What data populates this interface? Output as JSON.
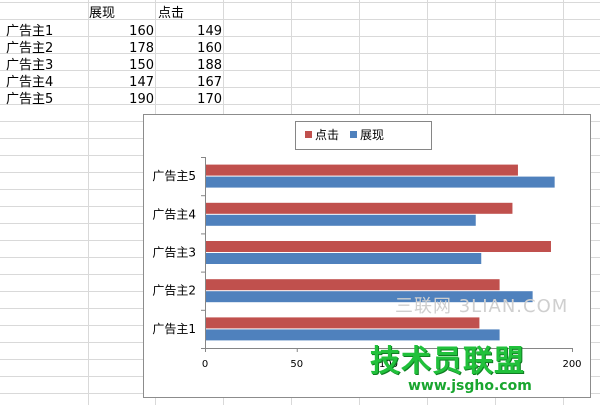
{
  "sheet": {
    "headers": [
      "展现",
      "点击"
    ],
    "rows": [
      {
        "label": "广告主1",
        "impressions": "160",
        "clicks": "149"
      },
      {
        "label": "广告主2",
        "impressions": "178",
        "clicks": "160"
      },
      {
        "label": "广告主3",
        "impressions": "150",
        "clicks": "188"
      },
      {
        "label": "广告主4",
        "impressions": "147",
        "clicks": "167"
      },
      {
        "label": "广告主5",
        "impressions": "190",
        "clicks": "170"
      }
    ]
  },
  "chart_data": {
    "type": "bar",
    "orientation": "horizontal",
    "categories": [
      "广告主1",
      "广告主2",
      "广告主3",
      "广告主4",
      "广告主5"
    ],
    "series": [
      {
        "name": "点击",
        "values": [
          149,
          160,
          188,
          167,
          170
        ],
        "color": "#c0504d"
      },
      {
        "name": "展现",
        "values": [
          160,
          178,
          150,
          147,
          190
        ],
        "color": "#4f81bd"
      }
    ],
    "xlim": [
      0,
      200
    ],
    "xticks": [
      "0",
      "50",
      "100",
      "150",
      "200"
    ],
    "legend": "top",
    "grid": false
  },
  "watermark": {
    "faint": "三联网 3LIAN.COM",
    "main": "技术员联盟",
    "url": "www.jsgho.com"
  }
}
